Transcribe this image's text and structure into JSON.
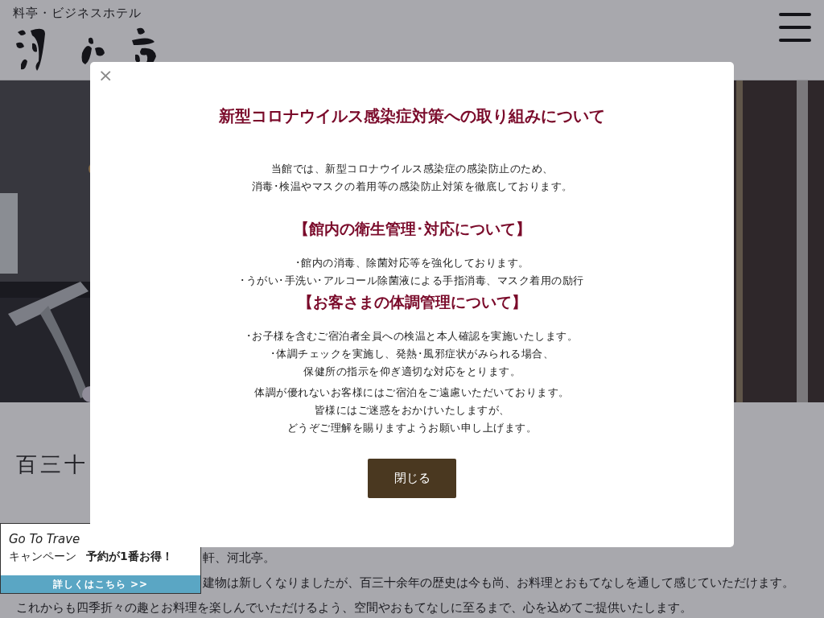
{
  "header": {
    "tagline": "料亭・ビジネスホテル"
  },
  "intro": {
    "heading": "百三十",
    "partial_lines": [
      "軒、河北亭。",
      "建物は新しくなりましたが、百三十余年の歴史は今も尚、お料理とおもてなしを通して感じていただけます。"
    ],
    "lines": [
      "これからも四季折々の趣とお料理を楽しんでいただけるよう、空間やおもてなしに至るまで、心を込めてご提供いたします。"
    ]
  },
  "banner": {
    "title": "Go To Trave",
    "subtitle": "キャンペーン",
    "tagline": "予約が1番お得！",
    "link": "詳しくはこちら >>"
  },
  "modal": {
    "close": "×",
    "title": "新型コロナウイルス感染症対策への取り組みについて",
    "intro": [
      "当館では、新型コロナウイルス感染症の感染防止のため、",
      "消毒･検温やマスクの着用等の感染防止対策を徹底しております。"
    ],
    "sections": [
      {
        "heading": "【館内の衛生管理･対応について】",
        "lines": [
          "･館内の消毒、除菌対応等を強化しております。",
          "･うがい･手洗い･アルコール除菌液による手指消毒、マスク着用の励行"
        ]
      },
      {
        "heading": "【お客さまの体調管理について】",
        "lines": [
          "･お子様を含むご宿泊者全員への検温と本人確認を実施いたします。",
          "･体調チェックを実施し、発熱･風邪症状がみられる場合、",
          "保健所の指示を仰ぎ適切な対応をとります。"
        ]
      }
    ],
    "notice": [
      "体調が優れないお客様にはご宿泊をご遠慮いただいております。",
      "皆様にはご迷惑をおかけいたしますが、",
      "どうぞご理解を賜りますようお願い申し上げます。"
    ],
    "button": "閉じる"
  }
}
